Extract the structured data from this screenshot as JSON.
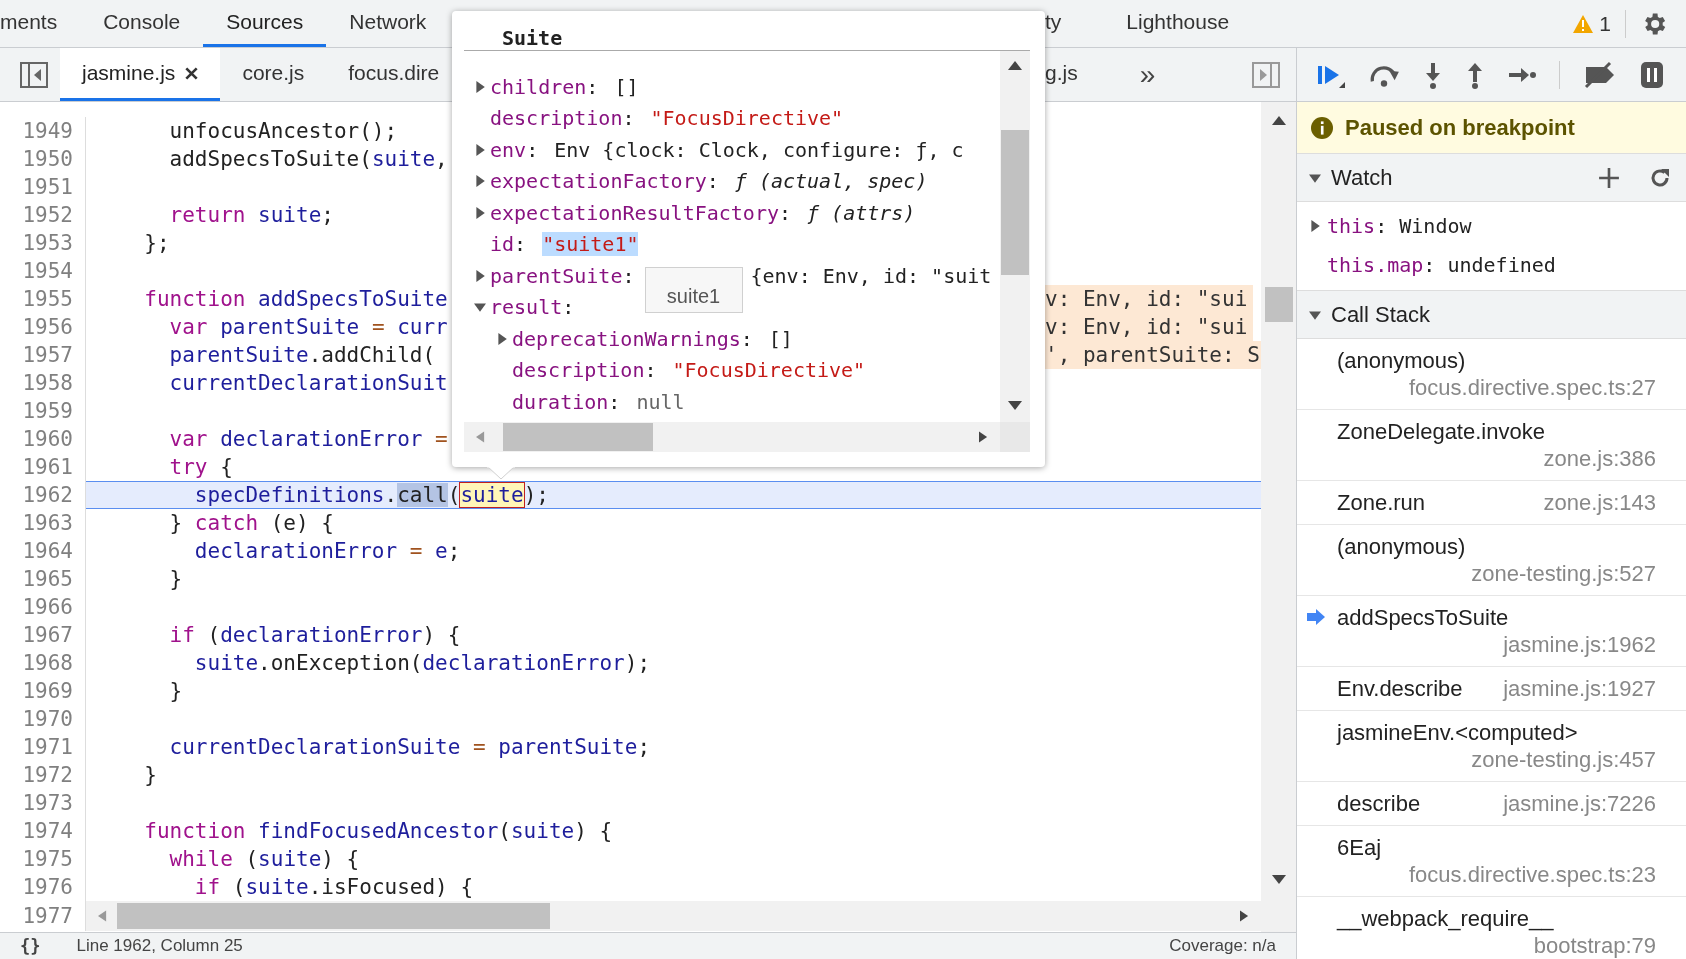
{
  "panel_tabs": [
    {
      "label": "ments",
      "selected": false
    },
    {
      "label": "Console",
      "selected": false
    },
    {
      "label": "Sources",
      "selected": true
    },
    {
      "label": "Network",
      "selected": false
    }
  ],
  "panel_tabs_right": [
    {
      "label": "ty",
      "selected": false
    },
    {
      "label": "Lighthouse",
      "selected": false
    }
  ],
  "warnings": {
    "count": "1"
  },
  "file_tabs": [
    {
      "label": "jasmine.js",
      "selected": true,
      "closable": true
    },
    {
      "label": "core.js",
      "selected": false,
      "closable": false
    },
    {
      "label": "focus.dire",
      "selected": false,
      "closable": false
    }
  ],
  "file_tabs_right": [
    {
      "label": "g.js",
      "selected": false,
      "closable": false
    }
  ],
  "more_tabs": "»",
  "code_lines": [
    {
      "number": "1949",
      "current": false,
      "segments": [
        {
          "kind": "plain",
          "text": "    unfocusAncestor();"
        }
      ]
    },
    {
      "number": "1950",
      "current": false,
      "segments": [
        {
          "kind": "plain",
          "text": "    addSpecsToSuite("
        },
        {
          "kind": "variable",
          "text": "suite"
        },
        {
          "kind": "plain",
          "text": ","
        }
      ]
    },
    {
      "number": "1951",
      "current": false
    },
    {
      "number": "1952",
      "current": false,
      "segments": [
        {
          "kind": "keyword",
          "text": "    return "
        },
        {
          "kind": "variable",
          "text": "suite"
        },
        {
          "kind": "plain",
          "text": ";"
        }
      ]
    },
    {
      "number": "1953",
      "current": false,
      "segments": [
        {
          "kind": "plain",
          "text": "  };"
        }
      ]
    },
    {
      "number": "1954",
      "current": false
    },
    {
      "number": "1955",
      "current": false,
      "segments": [
        {
          "kind": "keyword",
          "text": "  function "
        },
        {
          "kind": "variable",
          "text": "addSpecsToSuite"
        }
      ],
      "inline_value": "v: Env, id: \"sui"
    },
    {
      "number": "1956",
      "current": false,
      "segments": [
        {
          "kind": "keyword",
          "text": "    var "
        },
        {
          "kind": "variable",
          "text": "parentSuite"
        },
        {
          "kind": "operator",
          "text": " = "
        },
        {
          "kind": "variable",
          "text": "curr"
        }
      ],
      "inline_value": "v: Env, id: \"sui"
    },
    {
      "number": "1957",
      "current": false,
      "segments": [
        {
          "kind": "variable",
          "text": "    parentSuite"
        },
        {
          "kind": "plain",
          "text": ".addChild("
        }
      ],
      "inline_value": "', parentSuite: S"
    },
    {
      "number": "1958",
      "current": false,
      "segments": [
        {
          "kind": "variable",
          "text": "    currentDeclarationSuit"
        }
      ]
    },
    {
      "number": "1959",
      "current": false
    },
    {
      "number": "1960",
      "current": false,
      "segments": [
        {
          "kind": "keyword",
          "text": "    var "
        },
        {
          "kind": "variable",
          "text": "declarationError"
        },
        {
          "kind": "operator",
          "text": " ="
        }
      ]
    },
    {
      "number": "1961",
      "current": false,
      "segments": [
        {
          "kind": "keyword",
          "text": "    try"
        },
        {
          "kind": "plain",
          "text": " {"
        }
      ]
    },
    {
      "number": "1962",
      "current": true,
      "segments": [
        {
          "kind": "variable",
          "text": "      specDefinitions"
        },
        {
          "kind": "plain",
          "text": "."
        },
        {
          "kind": "selection",
          "text": "call"
        },
        {
          "kind": "plain",
          "text": "("
        },
        {
          "kind": "evaluated",
          "text": "suite"
        },
        {
          "kind": "plain",
          "text": ");"
        }
      ]
    },
    {
      "number": "1963",
      "current": false,
      "segments": [
        {
          "kind": "plain",
          "text": "    } "
        },
        {
          "kind": "keyword",
          "text": "catch"
        },
        {
          "kind": "plain",
          "text": " (e) {"
        }
      ]
    },
    {
      "number": "1964",
      "current": false,
      "segments": [
        {
          "kind": "variable",
          "text": "      declarationError"
        },
        {
          "kind": "operator",
          "text": " = "
        },
        {
          "kind": "variable",
          "text": "e"
        },
        {
          "kind": "plain",
          "text": ";"
        }
      ]
    },
    {
      "number": "1965",
      "current": false,
      "segments": [
        {
          "kind": "plain",
          "text": "    }"
        }
      ]
    },
    {
      "number": "1966",
      "current": false
    },
    {
      "number": "1967",
      "current": false,
      "segments": [
        {
          "kind": "keyword",
          "text": "    if"
        },
        {
          "kind": "plain",
          "text": " ("
        },
        {
          "kind": "variable",
          "text": "declarationError"
        },
        {
          "kind": "plain",
          "text": ") {"
        }
      ]
    },
    {
      "number": "1968",
      "current": false,
      "segments": [
        {
          "kind": "variable",
          "text": "      suite"
        },
        {
          "kind": "plain",
          "text": ".onException("
        },
        {
          "kind": "variable",
          "text": "declarationError"
        },
        {
          "kind": "plain",
          "text": ");"
        }
      ]
    },
    {
      "number": "1969",
      "current": false,
      "segments": [
        {
          "kind": "plain",
          "text": "    }"
        }
      ]
    },
    {
      "number": "1970",
      "current": false
    },
    {
      "number": "1971",
      "current": false,
      "segments": [
        {
          "kind": "variable",
          "text": "    currentDeclarationSuite"
        },
        {
          "kind": "operator",
          "text": " = "
        },
        {
          "kind": "variable",
          "text": "parentSuite"
        },
        {
          "kind": "plain",
          "text": ";"
        }
      ]
    },
    {
      "number": "1972",
      "current": false,
      "segments": [
        {
          "kind": "plain",
          "text": "  }"
        }
      ]
    },
    {
      "number": "1973",
      "current": false
    },
    {
      "number": "1974",
      "current": false,
      "segments": [
        {
          "kind": "keyword",
          "text": "  function "
        },
        {
          "kind": "variable",
          "text": "findFocusedAncestor"
        },
        {
          "kind": "plain",
          "text": "("
        },
        {
          "kind": "variable",
          "text": "suite"
        },
        {
          "kind": "plain",
          "text": ") {"
        }
      ]
    },
    {
      "number": "1975",
      "current": false,
      "segments": [
        {
          "kind": "keyword",
          "text": "    while"
        },
        {
          "kind": "plain",
          "text": " ("
        },
        {
          "kind": "variable",
          "text": "suite"
        },
        {
          "kind": "plain",
          "text": ") {"
        }
      ]
    },
    {
      "number": "1976",
      "current": false,
      "segments": [
        {
          "kind": "keyword",
          "text": "      if"
        },
        {
          "kind": "plain",
          "text": " ("
        },
        {
          "kind": "variable",
          "text": "suite"
        },
        {
          "kind": "plain",
          "text": ".isFocused) {"
        }
      ]
    }
  ],
  "last_line_number": "1977",
  "popover": {
    "title": "Suite",
    "properties": [
      {
        "name": "children:",
        "value": "[]",
        "kind": "array",
        "expanded": false
      },
      {
        "name": "description:",
        "value": "\"FocusDirective\"",
        "kind": "string"
      },
      {
        "name": "env:",
        "value": "Env {clock: Clock, configure: ƒ, c",
        "kind": "object",
        "expanded": false
      },
      {
        "name": "expectationFactory:",
        "value": "ƒ (actual, spec)",
        "kind": "function",
        "expanded": false
      },
      {
        "name": "expectationResultFactory:",
        "value": "ƒ (attrs)",
        "kind": "function",
        "expanded": false
      },
      {
        "name": "id:",
        "value": "\"suite1\"",
        "kind": "selected-string"
      },
      {
        "name": "parentSuite:",
        "value": "{env: Env, id: \"suit",
        "kind": "object",
        "expanded": false,
        "tooltip": "suite1"
      },
      {
        "name": "result:",
        "expanded": true,
        "children": [
          {
            "name": "deprecationWarnings:",
            "value": "[]",
            "kind": "array",
            "expanded": false
          },
          {
            "name": "description:",
            "value": "\"FocusDirective\"",
            "kind": "string"
          },
          {
            "name": "duration:",
            "value": "null",
            "kind": "null"
          }
        ]
      }
    ]
  },
  "status_bar": {
    "format_button": "{}",
    "position": "Line 1962, Column 25",
    "coverage": "Coverage: n/a"
  },
  "debugger": {
    "banner": "Paused on breakpoint",
    "watch": {
      "title": "Watch",
      "expanded": true,
      "items": [
        {
          "name": "this:",
          "value": "Window",
          "expanded": false
        },
        {
          "name": "this.map:",
          "value": "undefined"
        }
      ]
    },
    "call_stack": {
      "title": "Call Stack",
      "expanded": true,
      "frames": [
        {
          "function": "(anonymous)",
          "location": "focus.directive.spec.ts:27",
          "selected": false
        },
        {
          "function": "ZoneDelegate.invoke",
          "location": "zone.js:386",
          "selected": false
        },
        {
          "function": "Zone.run",
          "location": "zone.js:143",
          "selected": false
        },
        {
          "function": "(anonymous)",
          "location": "zone-testing.js:527",
          "selected": false
        },
        {
          "function": "addSpecsToSuite",
          "location": "jasmine.js:1962",
          "selected": true
        },
        {
          "function": "Env.describe",
          "location": "jasmine.js:1927",
          "selected": false
        },
        {
          "function": "jasmineEnv.<computed>",
          "location": "zone-testing.js:457",
          "selected": false
        },
        {
          "function": "describe",
          "location": "jasmine.js:7226",
          "selected": false
        },
        {
          "function": "6Eaj",
          "location": "focus.directive.spec.ts:23",
          "selected": false
        },
        {
          "function": "__webpack_require__",
          "location": "bootstrap:79",
          "selected": false
        }
      ]
    }
  }
}
